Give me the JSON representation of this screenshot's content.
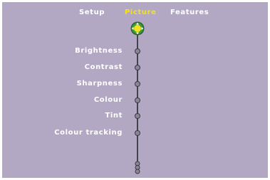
{
  "tabs": [
    {
      "label": "Setup",
      "active": false
    },
    {
      "label": "Picture",
      "active": true
    },
    {
      "label": "Features",
      "active": false
    }
  ],
  "menu": {
    "items": [
      {
        "label": "Brightness"
      },
      {
        "label": "Contrast"
      },
      {
        "label": "Sharpness"
      },
      {
        "label": "Colour"
      },
      {
        "label": "Tint"
      },
      {
        "label": "Colour tracking"
      }
    ]
  },
  "icons": {
    "navigation": "nav-joystick-icon",
    "more": "more-items-icon"
  },
  "colors": {
    "background": "#b2a8c4",
    "active_tab": "#f4e21c",
    "text": "#ffffff",
    "knob_ring": "#3e9a3c"
  }
}
